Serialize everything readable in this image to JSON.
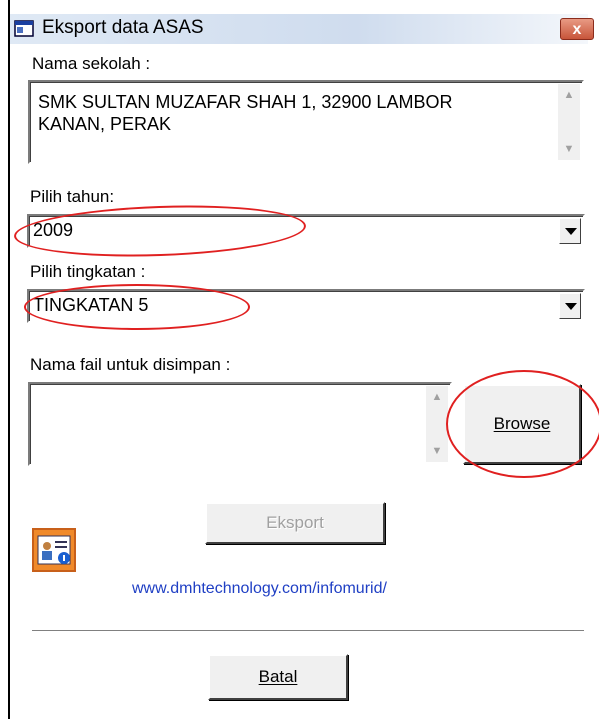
{
  "window": {
    "title": "Eksport data ASAS",
    "close_label": "x"
  },
  "school": {
    "label": "Nama sekolah :",
    "value_line1": "SMK SULTAN MUZAFAR SHAH 1, 32900 LAMBOR",
    "value_line2": "KANAN, PERAK"
  },
  "year": {
    "label": "Pilih tahun:",
    "value": "2009"
  },
  "level": {
    "label": "Pilih tingkatan :",
    "value": "TINGKATAN 5"
  },
  "file": {
    "label": "Nama fail untuk disimpan :",
    "value": "",
    "browse_label": "Browse"
  },
  "export_label": "Eksport",
  "link_text": "www.dmhtechnology.com/infomurid/",
  "cancel_label": "Batal",
  "colors": {
    "annotation": "#e02020",
    "link": "#1f3fc4"
  },
  "icons": [
    "window-icon",
    "close-icon",
    "app-logo-icon",
    "dropdown-arrow-icon",
    "scroll-up-icon",
    "scroll-down-icon"
  ]
}
